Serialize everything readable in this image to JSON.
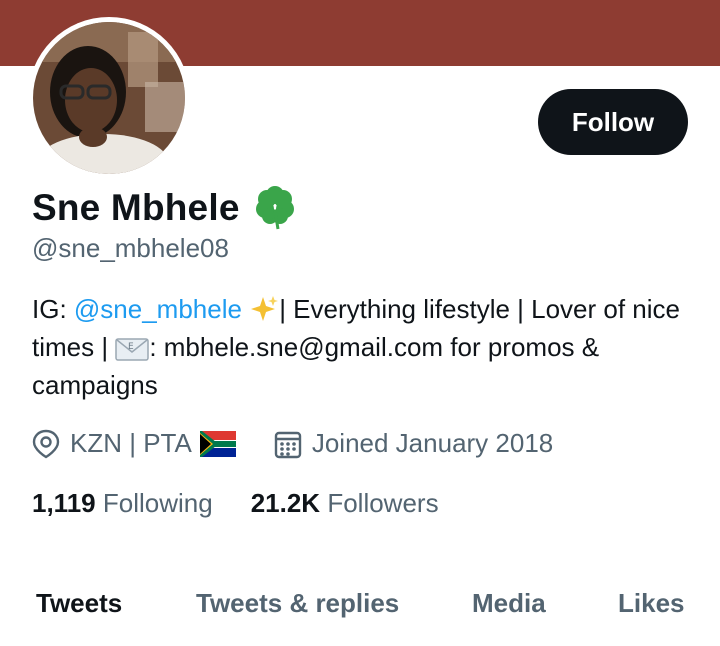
{
  "header": {
    "banner_color": "#8e3c32"
  },
  "profile": {
    "name": "Sne Mbhele",
    "name_emoji": "shamrock-icon",
    "handle": "@sne_mbhele08",
    "follow_label": "Follow",
    "bio": {
      "ig_prefix": "IG: ",
      "ig_link": "@sne_mbhele",
      "part1": "| Everything lifestyle | Lover of nice times | ",
      "part2": ": mbhele.sne@gmail.com for promos & campaigns"
    },
    "location": "KZN | PTA",
    "joined": "Joined January 2018",
    "stats": {
      "following_count": "1,119",
      "following_label": "Following",
      "followers_count": "21.2K",
      "followers_label": "Followers"
    }
  },
  "tabs": [
    {
      "label": "Tweets",
      "active": true
    },
    {
      "label": "Tweets & replies",
      "active": false
    },
    {
      "label": "Media",
      "active": false
    },
    {
      "label": "Likes",
      "active": false
    }
  ],
  "colors": {
    "accent": "#1d9bf0",
    "text": "#0f1419",
    "muted": "#536471"
  }
}
